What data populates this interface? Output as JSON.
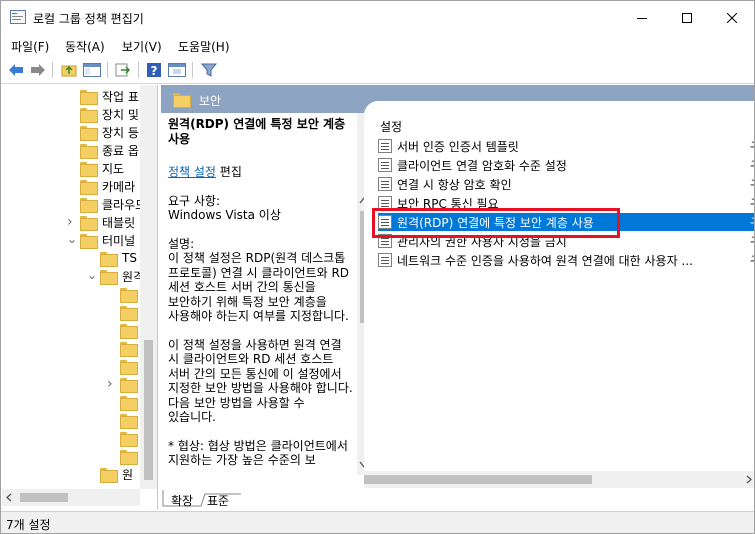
{
  "window": {
    "title": "로컬 그룹 정책 편집기"
  },
  "menu": [
    "파일(F)",
    "동작(A)",
    "보기(V)",
    "도움말(H)"
  ],
  "tree": {
    "items": [
      {
        "label": "작업 표",
        "indent": 1,
        "chev": ""
      },
      {
        "label": "장치 및",
        "indent": 1,
        "chev": ""
      },
      {
        "label": "장치 등",
        "indent": 1,
        "chev": ""
      },
      {
        "label": "종료 옵",
        "indent": 1,
        "chev": ""
      },
      {
        "label": "지도",
        "indent": 1,
        "chev": ""
      },
      {
        "label": "카메라",
        "indent": 1,
        "chev": ""
      },
      {
        "label": "클라우드",
        "indent": 1,
        "chev": ""
      },
      {
        "label": "태블릿",
        "indent": 1,
        "chev": ">"
      },
      {
        "label": "터미널",
        "indent": 1,
        "chev": "v"
      },
      {
        "label": "TS",
        "indent": 2,
        "chev": ""
      },
      {
        "label": "원격",
        "indent": 2,
        "chev": "v"
      },
      {
        "label": "",
        "indent": 3,
        "chev": ""
      },
      {
        "label": "",
        "indent": 3,
        "chev": ""
      },
      {
        "label": "",
        "indent": 3,
        "chev": ""
      },
      {
        "label": "",
        "indent": 3,
        "chev": ""
      },
      {
        "label": "",
        "indent": 3,
        "chev": ""
      },
      {
        "label": "",
        "indent": 3,
        "chev": ">"
      },
      {
        "label": "",
        "indent": 3,
        "chev": ""
      },
      {
        "label": "",
        "indent": 3,
        "chev": ""
      },
      {
        "label": "",
        "indent": 3,
        "chev": ""
      },
      {
        "label": "",
        "indent": 3,
        "chev": ""
      },
      {
        "label": "원",
        "indent": 2,
        "chev": ""
      }
    ]
  },
  "header": {
    "title": "보안"
  },
  "description": {
    "title": "원격(RDP) 연결에 특정 보안 계층 사용",
    "edit_link": "정책 설정",
    "edit_suffix": " 편집",
    "req_label": "요구 사항:",
    "req_value": "Windows Vista 이상",
    "desc_label": "설명:",
    "para1": "이 정책 설정은 RDP(원격 데스크톱 프로토콜) 연결 시 클라이언트와 RD 세션 호스트 서버 간의 통신을 보안하기 위해 특정 보안 계층을 사용해야 하는지 여부를 지정합니다.",
    "para2": "이 정책 설정을 사용하면 원격 연결 시 클라이언트와 RD 세션 호스트 서버 간의 모든 통신에 이 설정에서 지정한 보안 방법을 사용해야 합니다. 다음 보안 방법을 사용할 수 있습니다.",
    "para3": "* 협상: 협상 방법은 클라이언트에서 지원하는 가장 높은 수준의 보"
  },
  "list": {
    "column": "설정",
    "rows": [
      {
        "label": "서버 인증 인증서 템플릿",
        "state": "구성",
        "selected": false
      },
      {
        "label": "클라이언트 연결 암호화 수준 설정",
        "state": "구성",
        "selected": false
      },
      {
        "label": "연결 시 항상 암호 확인",
        "state": "구성",
        "selected": false
      },
      {
        "label": "보안 RPC 통신 필요",
        "state": "구성",
        "selected": false
      },
      {
        "label": "원격(RDP) 연결에 특정 보안 계층 사용",
        "state": "구성",
        "selected": true
      },
      {
        "label": "관리자의 권한 사용자 지정을 금지",
        "state": "구성",
        "selected": false
      },
      {
        "label": "네트워크 수준 인증을 사용하여 원격 연결에 대한 사용자 ...",
        "state": "구성",
        "selected": false
      }
    ]
  },
  "tabs": [
    "확장",
    "표준"
  ],
  "status": {
    "text": "7개 설정"
  },
  "colors": {
    "accent": "#0078d7",
    "header": "#8da3c2",
    "highlight": "#e81123"
  }
}
